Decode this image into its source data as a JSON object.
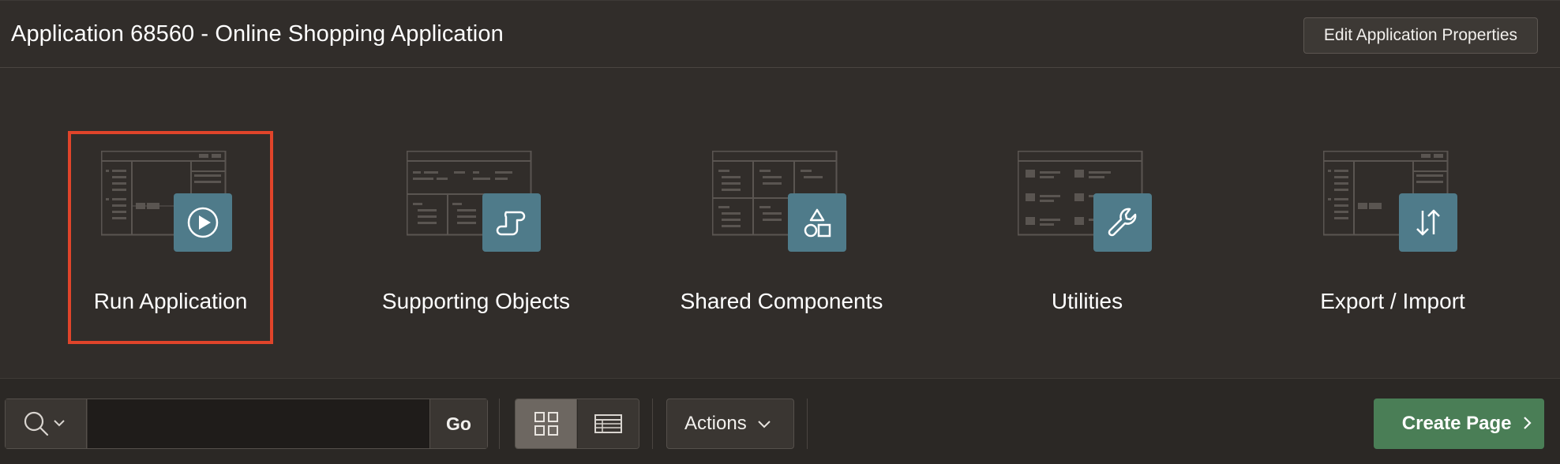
{
  "header": {
    "title": "Application 68560 - Online Shopping Application",
    "edit_button": "Edit Application Properties"
  },
  "tiles": [
    {
      "label": "Run Application",
      "icon": "play-icon",
      "selected": true
    },
    {
      "label": "Supporting Objects",
      "icon": "scroll-icon",
      "selected": false
    },
    {
      "label": "Shared Components",
      "icon": "shapes-icon",
      "selected": false
    },
    {
      "label": "Utilities",
      "icon": "wrench-icon",
      "selected": false
    },
    {
      "label": "Export / Import",
      "icon": "up-down-arrows-icon",
      "selected": false
    }
  ],
  "toolbar": {
    "search_value": "",
    "go_label": "Go",
    "actions_label": "Actions",
    "create_page_label": "Create Page",
    "active_view": "grid"
  },
  "colors": {
    "selected_border": "#e0442a",
    "badge": "#4f7b8a",
    "create_button": "#4a7e56"
  }
}
